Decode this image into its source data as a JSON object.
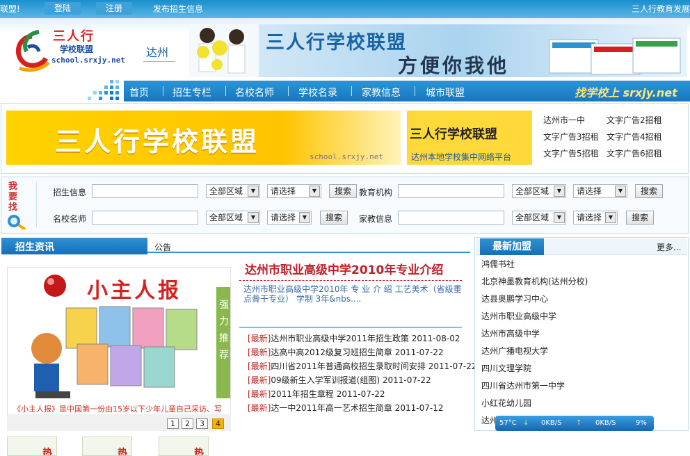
{
  "topbar": {
    "left_text": "联盟!",
    "login": "登陆",
    "register": "注册",
    "publish": "发布招生信息",
    "right_text": "三人行教育发展"
  },
  "logo": {
    "text": "三人行",
    "subtitle": "学校联盟",
    "url": "school.srxjy.net"
  },
  "city": "达州",
  "top_banner": {
    "title": "三人行学校联盟",
    "slogan": "方便你我他"
  },
  "nav": {
    "items": [
      "首页",
      "招生专栏",
      "名校名师",
      "学校名录",
      "家教信息",
      "城市联盟"
    ],
    "slogan": "找学校上 srxjy.net"
  },
  "ads": {
    "big_title": "三人行学校联盟",
    "big_url": "school.srxjy.net",
    "small_title": "三人行学校联盟",
    "small_sub": "达州本地学校集中网络平台",
    "text_ads": [
      "达州市一中",
      "文字广告2招租",
      "文字广告3招租",
      "文字广告4招租",
      "文字广告5招租",
      "文字广告6招租"
    ]
  },
  "search": {
    "badge": "我要找",
    "rows": [
      [
        {
          "label": "招生信息",
          "area": "全部区域",
          "choice": "请选择",
          "button": "搜索"
        },
        {
          "label": "教育机构",
          "area": "全部区域",
          "choice": "请选择",
          "button": "搜索"
        }
      ],
      [
        {
          "label": "名校名师",
          "area": "全部区域",
          "choice": "请选择",
          "button": "搜索"
        },
        {
          "label": "家教信息",
          "area": "全部区域",
          "choice": "请选择",
          "button": "搜索"
        }
      ]
    ]
  },
  "news": {
    "section_title": "招生资讯",
    "notice_label": "公告",
    "promo": {
      "title": "小主人报",
      "side": "强力推荐",
      "caption": "《小主人报》是中国第一份由15岁以下少年儿童自己采访、写稿、插图、摄影、编辑的报刊。",
      "pages": [
        "1",
        "2",
        "3",
        "4"
      ],
      "active_page": "4",
      "thumb_hot": "热"
    },
    "headline": "达州市职业高级中学2010年专业介绍",
    "summary": "达州市职业高级中学2010年 专 业 介 绍 工艺美术（省级重点骨干专业） 学制 3年&nbs....",
    "items": [
      {
        "tag": "[最新]",
        "title": "达州市职业高级中学2011年招生政策",
        "date": "2011-08-02"
      },
      {
        "tag": "[最新]",
        "title": "达高中高2012级复习班招生简章",
        "date": "2011-07-22"
      },
      {
        "tag": "[最新]",
        "title": "四川省2011年普通高校招生录取时间安排",
        "date": "2011-07-22"
      },
      {
        "tag": "[最新]",
        "title": "09级新生入学军训报道(组图)",
        "date": "2011-07-22"
      },
      {
        "tag": "[最新]",
        "title": "2011年招生章程",
        "date": "2011-07-22"
      },
      {
        "tag": "[最新]",
        "title": "达一中2011年高一艺术招生简章",
        "date": "2011-07-12"
      }
    ]
  },
  "latest": {
    "title": "最新加盟",
    "more": "更多...",
    "items": [
      "鸿儒书社",
      "北京神墨教育机构(达州分校)",
      "达县奥鹏学习中心",
      "达州市职业高级中学",
      "达州市高级中学",
      "达州广播电视大学",
      "四川文理学院",
      "四川省达州市第一中学",
      "小红花幼儿园",
      "达州"
    ]
  },
  "status": {
    "temp": "57°C",
    "down": "0KB/S",
    "up": "0KB/S",
    "percent": "9%"
  },
  "colors": {
    "primary_blue": "#1777bf",
    "accent_red": "#c0202a",
    "ad_yellow": "#ffd200"
  }
}
